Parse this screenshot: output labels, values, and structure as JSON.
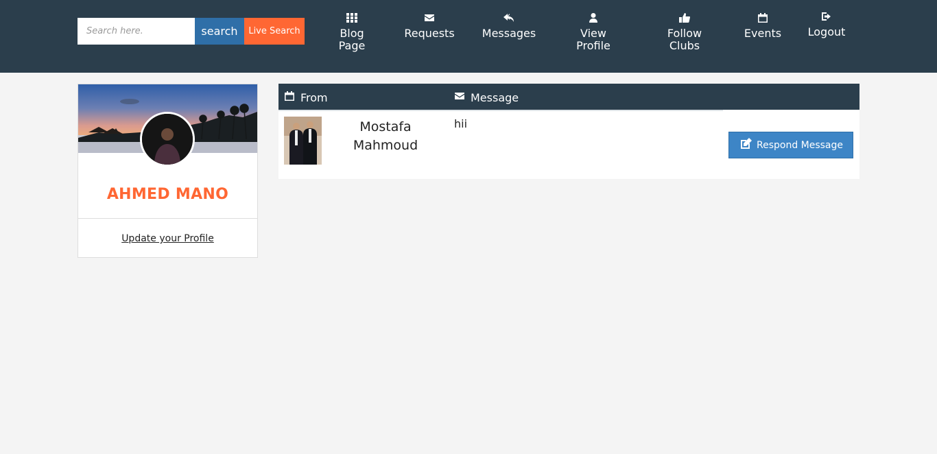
{
  "header": {
    "search_placeholder": "Search here.",
    "search_label": "search",
    "live_search_label": "Live Search",
    "nav": [
      {
        "label_line1": "Blog",
        "label_line2": "Page",
        "icon": "grid-icon"
      },
      {
        "label_line1": "Requests",
        "label_line2": "",
        "icon": "envelope-icon"
      },
      {
        "label_line1": "Messages",
        "label_line2": "",
        "icon": "reply-icon"
      },
      {
        "label_line1": "View",
        "label_line2": "Profile",
        "icon": "user-icon"
      },
      {
        "label_line1": "Follow",
        "label_line2": "Clubs",
        "icon": "thumbs-up-icon"
      },
      {
        "label_line1": "Events",
        "label_line2": "",
        "icon": "calendar-icon"
      },
      {
        "label_line1": "Logout",
        "label_line2": "",
        "icon": "sign-out-icon"
      }
    ]
  },
  "profile": {
    "name": "AHMED MANO",
    "update_link": "Update your Profile"
  },
  "messages": {
    "col_from": "From",
    "col_message": "Message",
    "rows": [
      {
        "sender_line1": "Mostafa",
        "sender_line2": "Mahmoud",
        "text": "hii",
        "action": "Respond Message"
      }
    ]
  },
  "colors": {
    "navbar": "#2b3e4c",
    "accent_orange": "#ff6733",
    "button_blue": "#3d85c6",
    "search_blue": "#2f6fa8"
  }
}
